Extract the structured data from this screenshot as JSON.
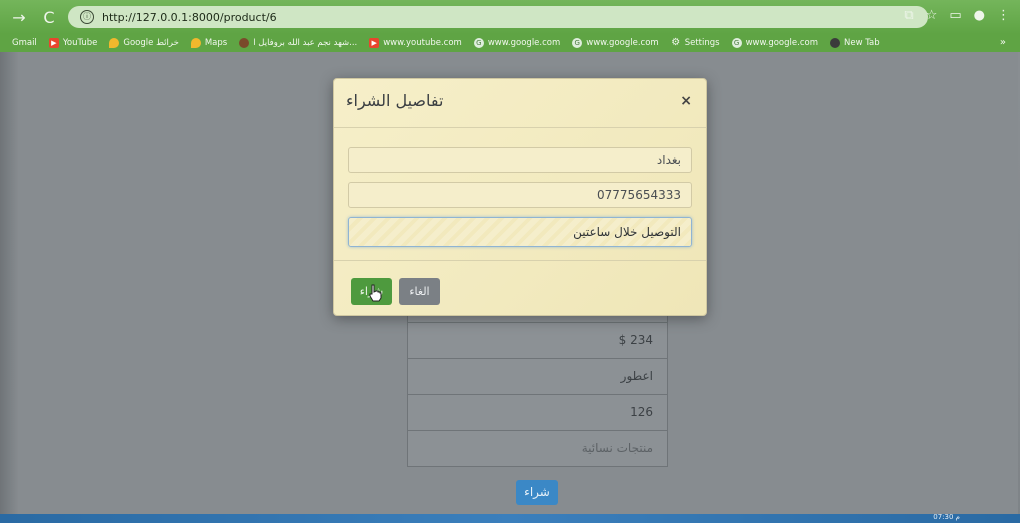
{
  "browser": {
    "url": "http://127.0.0.1:8000/product/6",
    "nav_back": "→",
    "nav_reload": "C",
    "info_icon": "ⓘ",
    "bookmarks": [
      {
        "label": "Gmail",
        "icon": ""
      },
      {
        "label": "YouTube",
        "icon": "yt"
      },
      {
        "label": "Google خرائط",
        "icon": "maps"
      },
      {
        "label": "Maps",
        "icon": "maps"
      },
      {
        "label": "شهد نجم عبد الله بروفايل ا...",
        "icon": "round"
      },
      {
        "label": "www.youtube.com",
        "icon": "yt"
      },
      {
        "label": "www.google.com",
        "icon": "g"
      },
      {
        "label": "www.google.com",
        "icon": "g"
      },
      {
        "label": "Settings",
        "icon": "gear"
      },
      {
        "label": "www.google.com",
        "icon": "g"
      },
      {
        "label": "New Tab",
        "icon": "newtab"
      }
    ],
    "bookmarks_more": "»"
  },
  "modal": {
    "title": "تفاصيل الشراء",
    "close": "×",
    "city": "بغداد",
    "phone": "07775654333",
    "notes": "التوصيل خلال ساعتين",
    "buy_label": "شراء",
    "cancel_label": "الغاء"
  },
  "product": {
    "rows": [
      "",
      "234 $",
      "اعطور",
      "126",
      "منتجات نسائية"
    ],
    "buy_label": "شراء"
  },
  "taskbar": {
    "clock": "07:30 م"
  }
}
